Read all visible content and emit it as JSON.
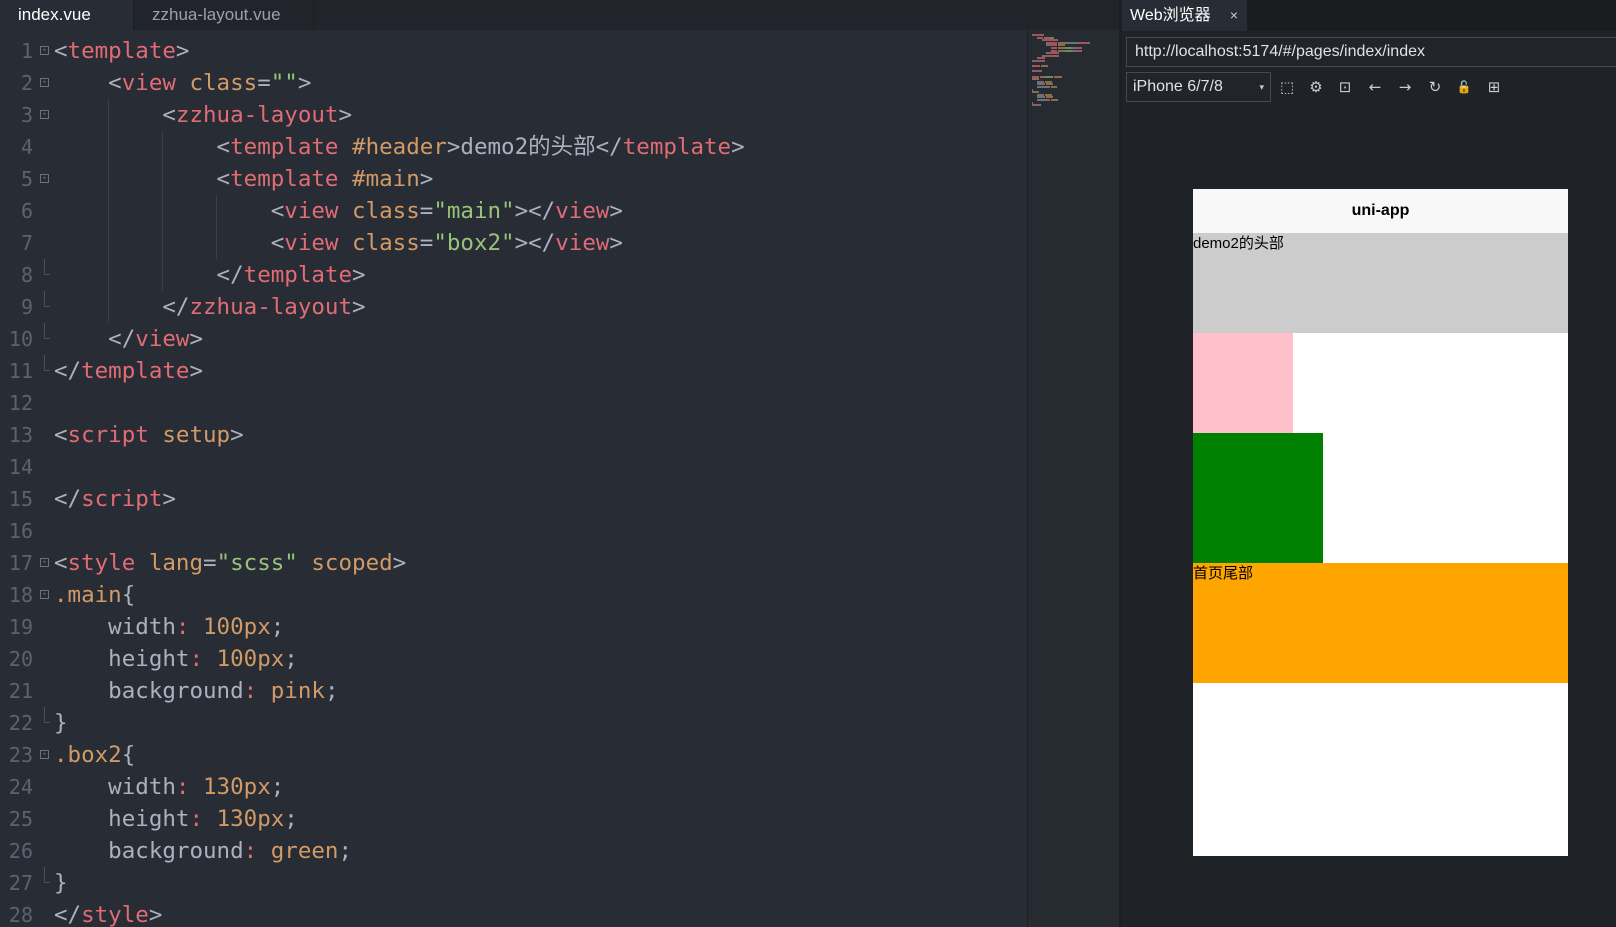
{
  "editor": {
    "tabs": [
      {
        "label": "index.vue",
        "active": true
      },
      {
        "label": "zzhua-layout.vue",
        "active": false
      }
    ],
    "lines": [
      {
        "n": "1",
        "fold": "open",
        "tokens": [
          [
            "punc",
            "<"
          ],
          [
            "tag",
            "template"
          ],
          [
            "punc",
            ">"
          ]
        ]
      },
      {
        "n": "2",
        "fold": "open",
        "tokens": [
          [
            "punc",
            "    <"
          ],
          [
            "tag",
            "view"
          ],
          [
            "text",
            " "
          ],
          [
            "attr",
            "class"
          ],
          [
            "punc",
            "="
          ],
          [
            "str",
            "\"\""
          ],
          [
            "punc",
            ">"
          ]
        ]
      },
      {
        "n": "3",
        "fold": "open",
        "tokens": [
          [
            "punc",
            "        <"
          ],
          [
            "tag",
            "zzhua-layout"
          ],
          [
            "punc",
            ">"
          ]
        ]
      },
      {
        "n": "4",
        "fold": "",
        "tokens": [
          [
            "punc",
            "            <"
          ],
          [
            "tag",
            "template"
          ],
          [
            "text",
            " "
          ],
          [
            "attr",
            "#header"
          ],
          [
            "punc",
            ">"
          ],
          [
            "text",
            "demo2的头部"
          ],
          [
            "punc",
            "</"
          ],
          [
            "tag",
            "template"
          ],
          [
            "punc",
            ">"
          ]
        ]
      },
      {
        "n": "5",
        "fold": "open",
        "tokens": [
          [
            "punc",
            "            <"
          ],
          [
            "tag",
            "template"
          ],
          [
            "text",
            " "
          ],
          [
            "attr",
            "#main"
          ],
          [
            "punc",
            ">"
          ]
        ]
      },
      {
        "n": "6",
        "fold": "",
        "tokens": [
          [
            "punc",
            "                <"
          ],
          [
            "tag",
            "view"
          ],
          [
            "text",
            " "
          ],
          [
            "attr",
            "class"
          ],
          [
            "punc",
            "="
          ],
          [
            "str",
            "\"main\""
          ],
          [
            "punc",
            "></"
          ],
          [
            "tag",
            "view"
          ],
          [
            "punc",
            ">"
          ]
        ]
      },
      {
        "n": "7",
        "fold": "",
        "tokens": [
          [
            "punc",
            "                <"
          ],
          [
            "tag",
            "view"
          ],
          [
            "text",
            " "
          ],
          [
            "attr",
            "class"
          ],
          [
            "punc",
            "="
          ],
          [
            "str",
            "\"box2\""
          ],
          [
            "punc",
            "></"
          ],
          [
            "tag",
            "view"
          ],
          [
            "punc",
            ">"
          ]
        ]
      },
      {
        "n": "8",
        "fold": "end",
        "tokens": [
          [
            "punc",
            "            </"
          ],
          [
            "tag",
            "template"
          ],
          [
            "punc",
            ">"
          ]
        ]
      },
      {
        "n": "9",
        "fold": "end",
        "tokens": [
          [
            "punc",
            "        </"
          ],
          [
            "tag",
            "zzhua-layout"
          ],
          [
            "punc",
            ">"
          ]
        ]
      },
      {
        "n": "10",
        "fold": "end",
        "tokens": [
          [
            "punc",
            "    </"
          ],
          [
            "tag",
            "view"
          ],
          [
            "punc",
            ">"
          ]
        ]
      },
      {
        "n": "11",
        "fold": "end",
        "tokens": [
          [
            "punc",
            "</"
          ],
          [
            "tag",
            "template"
          ],
          [
            "punc",
            ">"
          ]
        ]
      },
      {
        "n": "12",
        "fold": "",
        "tokens": []
      },
      {
        "n": "13",
        "fold": "",
        "tokens": [
          [
            "punc",
            "<"
          ],
          [
            "tag",
            "script"
          ],
          [
            "text",
            " "
          ],
          [
            "attr",
            "setup"
          ],
          [
            "punc",
            ">"
          ]
        ]
      },
      {
        "n": "14",
        "fold": "",
        "tokens": []
      },
      {
        "n": "15",
        "fold": "",
        "tokens": [
          [
            "punc",
            "</"
          ],
          [
            "tag",
            "script"
          ],
          [
            "punc",
            ">"
          ]
        ]
      },
      {
        "n": "16",
        "fold": "",
        "tokens": []
      },
      {
        "n": "17",
        "fold": "open",
        "tokens": [
          [
            "punc",
            "<"
          ],
          [
            "tag",
            "style"
          ],
          [
            "text",
            " "
          ],
          [
            "attr",
            "lang"
          ],
          [
            "punc",
            "="
          ],
          [
            "str",
            "\"scss\""
          ],
          [
            "text",
            " "
          ],
          [
            "attr",
            "scoped"
          ],
          [
            "punc",
            ">"
          ]
        ]
      },
      {
        "n": "18",
        "fold": "open",
        "tokens": [
          [
            "sel",
            ".main"
          ],
          [
            "punc",
            "{"
          ]
        ]
      },
      {
        "n": "19",
        "fold": "",
        "tokens": [
          [
            "prop",
            "    width"
          ],
          [
            "colon",
            ":"
          ],
          [
            "text",
            " "
          ],
          [
            "val",
            "100px"
          ],
          [
            "punc",
            ";"
          ]
        ]
      },
      {
        "n": "20",
        "fold": "",
        "tokens": [
          [
            "prop",
            "    height"
          ],
          [
            "colon",
            ":"
          ],
          [
            "text",
            " "
          ],
          [
            "val",
            "100px"
          ],
          [
            "punc",
            ";"
          ]
        ]
      },
      {
        "n": "21",
        "fold": "",
        "tokens": [
          [
            "prop",
            "    background"
          ],
          [
            "colon",
            ":"
          ],
          [
            "text",
            " "
          ],
          [
            "val",
            "pink"
          ],
          [
            "punc",
            ";"
          ]
        ]
      },
      {
        "n": "22",
        "fold": "end",
        "tokens": [
          [
            "punc",
            "}"
          ]
        ]
      },
      {
        "n": "23",
        "fold": "open",
        "tokens": [
          [
            "sel",
            ".box2"
          ],
          [
            "punc",
            "{"
          ]
        ]
      },
      {
        "n": "24",
        "fold": "",
        "tokens": [
          [
            "prop",
            "    width"
          ],
          [
            "colon",
            ":"
          ],
          [
            "text",
            " "
          ],
          [
            "val",
            "130px"
          ],
          [
            "punc",
            ";"
          ]
        ]
      },
      {
        "n": "25",
        "fold": "",
        "tokens": [
          [
            "prop",
            "    height"
          ],
          [
            "colon",
            ":"
          ],
          [
            "text",
            " "
          ],
          [
            "val",
            "130px"
          ],
          [
            "punc",
            ";"
          ]
        ]
      },
      {
        "n": "26",
        "fold": "",
        "tokens": [
          [
            "prop",
            "    background"
          ],
          [
            "colon",
            ":"
          ],
          [
            "text",
            " "
          ],
          [
            "val",
            "green"
          ],
          [
            "punc",
            ";"
          ]
        ]
      },
      {
        "n": "27",
        "fold": "end",
        "tokens": [
          [
            "punc",
            "}"
          ]
        ]
      },
      {
        "n": "28",
        "fold": "",
        "tokens": [
          [
            "punc",
            "</"
          ],
          [
            "tag",
            "style"
          ],
          [
            "punc",
            ">"
          ]
        ]
      }
    ]
  },
  "browser": {
    "tab_label": "Web浏览器",
    "tab_close": "×",
    "url": "http://localhost:5174/#/pages/index/index",
    "device": "iPhone 6/7/8",
    "device_caret": "▾",
    "tools": [
      {
        "name": "screenshot-icon",
        "glyph": "⬚"
      },
      {
        "name": "settings-icon",
        "glyph": "⚙"
      },
      {
        "name": "console-icon",
        "glyph": "⊡"
      },
      {
        "name": "back-arrow-icon",
        "glyph": "←"
      },
      {
        "name": "forward-arrow-icon",
        "glyph": "→"
      },
      {
        "name": "reload-icon",
        "glyph": "↻"
      },
      {
        "name": "lock-icon",
        "glyph": "🔓"
      },
      {
        "name": "qrcode-icon",
        "glyph": "⊞"
      }
    ]
  },
  "phone": {
    "nav_title": "uni-app",
    "header_text": "demo2的头部",
    "footer_text": "首页尾部",
    "colors": {
      "header_bg": "#cccccc",
      "main_bg": "pink",
      "box2_bg": "green",
      "footer_bg": "orange",
      "page_bg": "#ffffff"
    }
  }
}
